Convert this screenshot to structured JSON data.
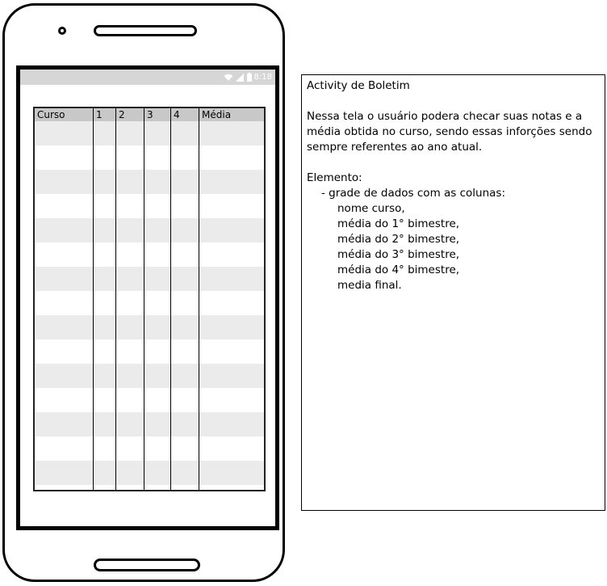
{
  "status_bar": {
    "time": "8:18",
    "icons": [
      "wifi-icon",
      "signal-icon",
      "battery-icon"
    ]
  },
  "grid": {
    "columns": [
      "Curso",
      "1",
      "2",
      "3",
      "4",
      "Média"
    ],
    "row_count": 15
  },
  "notes": {
    "title": "Activity de Boletim",
    "description": "Nessa tela o usuário podera checar suas notas e a média obtida no curso, sendo essas inforções sendo sempre referentes ao ano atual.",
    "element_heading": "Elemento:",
    "element_item": "- grade de dados com as colunas:",
    "column_lines": [
      "nome curso,",
      "média do 1° bimestre,",
      "média do 2° bimestre,",
      "média do 3° bimestre,",
      "média do 4° bimestre,",
      "media final."
    ]
  }
}
